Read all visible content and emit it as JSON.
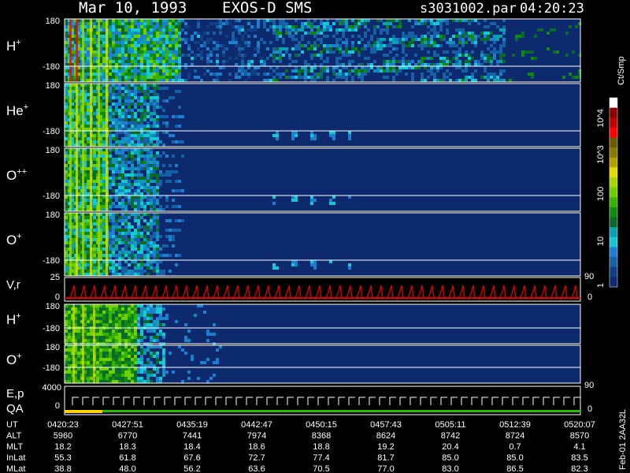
{
  "header": {
    "date": "Mar 10, 1993",
    "instrument": "EXOS-D SMS",
    "file": "s3031002.par",
    "time": "04:20:23"
  },
  "panels": [
    {
      "label": "H",
      "sup": "+",
      "top": "180",
      "bottom": "-180"
    },
    {
      "label": "He",
      "sup": "+",
      "top": "180",
      "bottom": "-180"
    },
    {
      "label": "O",
      "sup": "++",
      "top": "180",
      "bottom": "-180"
    },
    {
      "label": "O",
      "sup": "+",
      "top": "180",
      "bottom": "-180"
    }
  ],
  "velocity_panel": {
    "label": "V,r",
    "top": "25",
    "bottom": "0",
    "right_top": "90",
    "right_bottom": "0"
  },
  "lower_panels": [
    {
      "label": "H",
      "sup": "+",
      "top": "180",
      "bottom": "-180"
    },
    {
      "label": "O",
      "sup": "+",
      "top": "180",
      "bottom": "-180"
    }
  ],
  "ep_panel": {
    "label1": "E,p",
    "label2": "QA",
    "top": "4000",
    "bottom": "0",
    "right_top": "90",
    "right_bottom": "0"
  },
  "colorbar": {
    "unit": "Ct/Smp",
    "ticks": [
      "10^4",
      "10^3",
      "100",
      "10",
      "1"
    ],
    "colors": [
      "#ffffff",
      "#8b0000",
      "#c00000",
      "#ff0000",
      "#6b5a00",
      "#8a7a00",
      "#b5a000",
      "#dddd00",
      "#a6d600",
      "#6fcf00",
      "#35b300",
      "#0f8a10",
      "#0a6a2a",
      "#0aa0b0",
      "#14c8d6",
      "#1e7fd0",
      "#1660a8",
      "#123f84",
      "#0e2a6e"
    ]
  },
  "side_label": "Feb-01 2AA32L",
  "chart_data": {
    "type": "heatmap",
    "title": "Mar 10, 1993  EXOS-D SMS",
    "xlabel": "UT",
    "x_ticks": [
      "0420:23",
      "0427:51",
      "0435:19",
      "0442:47",
      "0450:15",
      "0457:43",
      "0505:11",
      "0512:39",
      "0520:07"
    ],
    "ylim": [
      -180,
      180
    ],
    "color_scale": "log",
    "color_range": [
      1,
      10000
    ]
  },
  "ephemeris": {
    "rows": [
      {
        "name": "UT",
        "values": [
          "0420:23",
          "0427:51",
          "0435:19",
          "0442:47",
          "0450:15",
          "0457:43",
          "0505:11",
          "0512:39",
          "0520:07"
        ]
      },
      {
        "name": "ALT",
        "values": [
          "5960",
          "6770",
          "7441",
          "7974",
          "8368",
          "8624",
          "8742",
          "8724",
          "8570"
        ]
      },
      {
        "name": "MLT",
        "values": [
          "18.2",
          "18.3",
          "18.4",
          "18.6",
          "18.8",
          "19.2",
          "20.4",
          "0.7",
          "4.1"
        ]
      },
      {
        "name": "InLat",
        "values": [
          "55.3",
          "61.8",
          "67.6",
          "72.7",
          "77.4",
          "81.7",
          "85.0",
          "85.0",
          "83.5"
        ]
      },
      {
        "name": "MLat",
        "values": [
          "38.8",
          "48.0",
          "56.2",
          "63.6",
          "70.5",
          "77.0",
          "83.0",
          "86.5",
          "82.3"
        ]
      }
    ]
  }
}
